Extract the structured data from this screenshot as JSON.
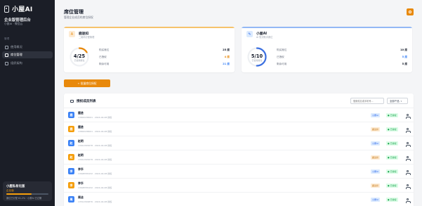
{
  "app": {
    "logo_text": "小屋AI",
    "org_name": "企业版管理后台",
    "org_sub": "小屋AI · 微信云"
  },
  "nav": {
    "section": "管理",
    "items": [
      {
        "label": "使用概况",
        "icon": "chart-icon"
      },
      {
        "label": "席位管理",
        "icon": "seat-icon"
      },
      {
        "label": "组织架构",
        "icon": "org-icon"
      }
    ],
    "active_index": 1
  },
  "promo": {
    "title": "小屋私有化版",
    "badge": "企业版",
    "text": "席位已分配 61.2% · 小屋AI 已过期",
    "progress": 0.6
  },
  "header": {
    "title": "席位管理",
    "subtitle": "管理企业成员的席位授权"
  },
  "cards": [
    {
      "name": "鹿途扣",
      "desc": "二维码分配管理",
      "icon": "A",
      "icon_bg": "#fdebd3",
      "icon_color": "#e8890c",
      "accent": "#f6c36b",
      "ring_color": "#e8890c",
      "ring_value": "4/25",
      "ring_label": "已使用席位",
      "ring_fraction": 0.16,
      "stats": [
        {
          "label": "购买席位",
          "value": "25 席",
          "color": "default"
        },
        {
          "label": "已授权",
          "value": "4 席",
          "color": "orange"
        },
        {
          "label": "剩余可用",
          "value": "21 席",
          "color": "blue"
        }
      ]
    },
    {
      "name": "小屋AI",
      "desc": "AI 知识助手席位",
      "icon": "✎",
      "icon_bg": "#dbeafe",
      "icon_color": "#2563eb",
      "accent": "#93b8f5",
      "ring_color": "#3b6fe0",
      "ring_value": "5/10",
      "ring_label": "已使用席位",
      "ring_fraction": 0.5,
      "stats": [
        {
          "label": "购买席位",
          "value": "10 席",
          "color": "default"
        },
        {
          "label": "已授权",
          "value": "5 席",
          "color": "blue"
        },
        {
          "label": "剩余可用",
          "value": "5 席",
          "color": "default"
        }
      ]
    }
  ],
  "assign_button": "+ 批量席位授权",
  "list": {
    "title": "授权成员列表",
    "search_placeholder": "搜索姓名或手机号...",
    "filter": "全部产品",
    "rows": [
      {
        "initial": "鹿",
        "name": "鹿途",
        "meta": "13800138001 · 2024-04-08 授权",
        "avatar": "#3b82f6",
        "product": "小屋AI",
        "product_kind": "blue",
        "status": "● 已授权"
      },
      {
        "initial": "鹿",
        "name": "鹿途",
        "meta": "13800138001 · 2024-04-08 授权",
        "avatar": "#f59e0b",
        "product": "鹿途扣",
        "product_kind": "orange",
        "status": "● 已授权"
      },
      {
        "initial": "赵",
        "name": "赵明",
        "meta": "13912345678 · 2024-04-08 授权",
        "avatar": "#3b82f6",
        "product": "小屋AI",
        "product_kind": "blue",
        "status": "● 已授权"
      },
      {
        "initial": "赵",
        "name": "赵明",
        "meta": "13912345678 · 2024-04-08 授权",
        "avatar": "#f59e0b",
        "product": "鹿途扣",
        "product_kind": "orange",
        "status": "● 已授权"
      },
      {
        "initial": "李",
        "name": "李华",
        "meta": "13698765432 · 2024-04-08 授权",
        "avatar": "#3b82f6",
        "product": "小屋AI",
        "product_kind": "blue",
        "status": "● 已授权"
      },
      {
        "initial": "李",
        "name": "李华",
        "meta": "13698765432 · 2024-04-08 授权",
        "avatar": "#f59e0b",
        "product": "鹿途扣",
        "product_kind": "orange",
        "status": "● 已授权"
      },
      {
        "initial": "周",
        "name": "周洁",
        "meta": "13512349876 · 2024-04-08 授权",
        "avatar": "#3b82f6",
        "product": "小屋AI",
        "product_kind": "blue",
        "status": "● 已授权"
      }
    ]
  },
  "colors": {
    "primary": "#e8890c",
    "sidebar_bg": "#1b1e27",
    "blue_tag_bg": "#dbeafe",
    "blue_tag_fg": "#2563eb",
    "orange_tag_bg": "#fdebd3",
    "orange_tag_fg": "#c2710c"
  }
}
